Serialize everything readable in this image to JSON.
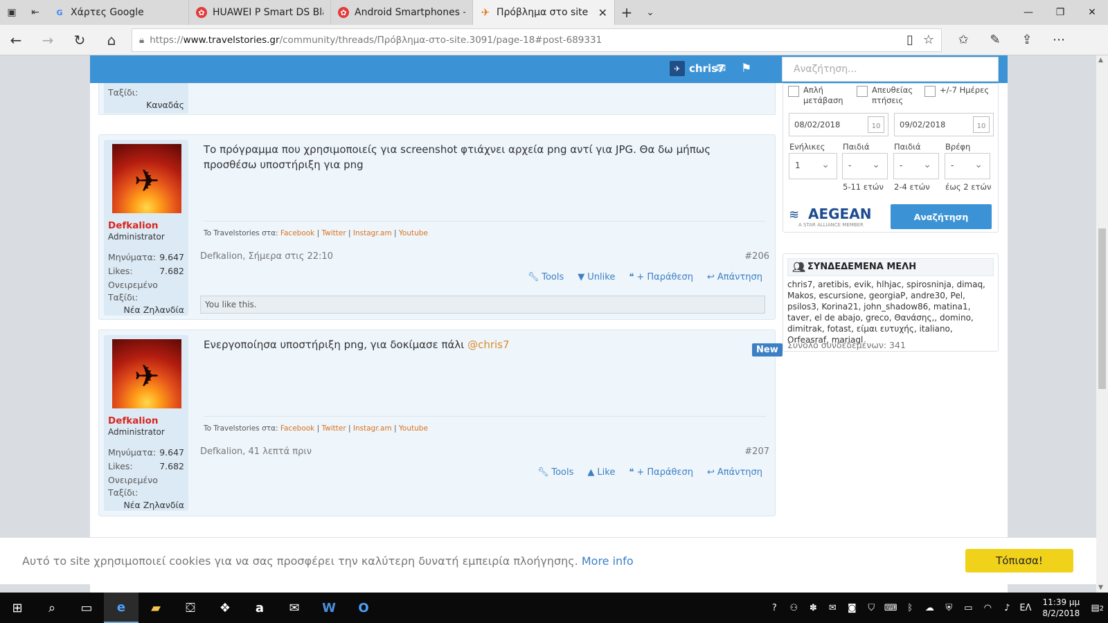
{
  "browser": {
    "tabs": [
      {
        "title": "Χάρτες Google",
        "active": false
      },
      {
        "title": "HUAWEI P Smart DS Black A",
        "active": false
      },
      {
        "title": "Android Smartphones - Κιν",
        "active": false
      },
      {
        "title": "Πρόβλημα στο site | Σε",
        "active": true
      }
    ],
    "url_prefix": "https://",
    "url_domain": "www.travelstories.gr",
    "url_path": "/community/threads/Πρόβλημα-στο-site.3091/page-18#post-689331"
  },
  "header": {
    "username": "chris7",
    "search_placeholder": "Αναζήτηση..."
  },
  "top_fragment": {
    "field_label": "Ταξίδι:",
    "location": "Καναδάς"
  },
  "posts": [
    {
      "author": "Defkalion",
      "role": "Administrator",
      "messages_label": "Μηνύματα:",
      "messages": "9.647",
      "likes_label": "Likes:",
      "likes": "7.682",
      "dream_label_1": "Ονειρεμένο",
      "dream_label_2": "Ταξίδι:",
      "dream": "Νέα Ζηλανδία",
      "text": "Το πρόγραμμα που χρησιμοποιείς για screenshot φτιάχνει αρχεία png αντί για JPG. Θα δω μήπως προσθέσω υποστήριξη για png",
      "mention": "",
      "signature_prefix": "To Travelstories στα:",
      "signature_links": [
        "Facebook",
        "Twitter",
        "Instagr.am",
        "Youtube"
      ],
      "meta": "Defkalion, Σήμερα στις 22:10",
      "number": "#206",
      "actions": [
        "Tools",
        "Unlike",
        "+ Παράθεση",
        "Απάντηση"
      ],
      "like_note": "You like this."
    },
    {
      "author": "Defkalion",
      "role": "Administrator",
      "messages_label": "Μηνύματα:",
      "messages": "9.647",
      "likes_label": "Likes:",
      "likes": "7.682",
      "dream_label_1": "Ονειρεμένο",
      "dream_label_2": "Ταξίδι:",
      "dream": "Νέα Ζηλανδία",
      "text": "Ενεργοποίησα υποστήριξη png, για δοκίμασε πάλι ",
      "mention": "@chris7",
      "badge": "New",
      "signature_prefix": "To Travelstories στα:",
      "signature_links": [
        "Facebook",
        "Twitter",
        "Instagr.am",
        "Youtube"
      ],
      "meta": "Defkalion, 41 λεπτά πριν",
      "number": "#207",
      "actions": [
        "Tools",
        "Like",
        "+ Παράθεση",
        "Απάντηση"
      ]
    }
  ],
  "flight_search": {
    "checkboxes": [
      {
        "line1": "Απλή",
        "line2": "μετάβαση"
      },
      {
        "line1": "Απευθείας",
        "line2": "πτήσεις"
      },
      {
        "line1": "+/-7 Ημέρες",
        "line2": ""
      }
    ],
    "date_from": "08/02/2018",
    "date_to": "09/02/2018",
    "calendar_glyph": "10",
    "selects": [
      {
        "label": "Ενήλικες",
        "value": "1",
        "age": ""
      },
      {
        "label": "Παιδιά",
        "value": "-",
        "age": "5-11 ετών"
      },
      {
        "label": "Παιδιά",
        "value": "-",
        "age": "2-4 ετών"
      },
      {
        "label": "Βρέφη",
        "value": "-",
        "age": "έως 2 ετών"
      }
    ],
    "airline": "AEGEAN",
    "airline_tag": "A STAR ALLIANCE MEMBER",
    "button": "Αναζήτηση"
  },
  "members": {
    "title": "ΣΥΝΔΕΔΕΜΕΝΑ ΜΕΛΗ",
    "list": "chris7, aretibis, evik, hlhjac, spirosninja, dimaq, Makos, escursione, georgiaP, andre30, Pel, psilos3, Korina21, john_shadow86, matina1, taver, el de abajo, greco, Θανάσης,, domino, dimitrak, fotast, είμαι ευτυχής, italiano, Orfeasraf, mariagl",
    "total": "Σύνολο συνδεδεμένων: 341"
  },
  "cookie": {
    "message": "Αυτό το site χρησιμοποιεί cookies για να σας προσφέρει την καλύτερη δυνατή εμπειρία πλοήγησης. ",
    "more": "More info",
    "button": "Τόπιασα!"
  },
  "taskbar": {
    "lang": "ΕΛ",
    "time": "11:39 μμ",
    "date": "8/2/2018",
    "notifications": "2"
  },
  "colors": {
    "brand_blue": "#3b93d6",
    "author_red": "#d9251d",
    "link_orange": "#d9731d",
    "accept_yellow": "#f1d21b"
  }
}
